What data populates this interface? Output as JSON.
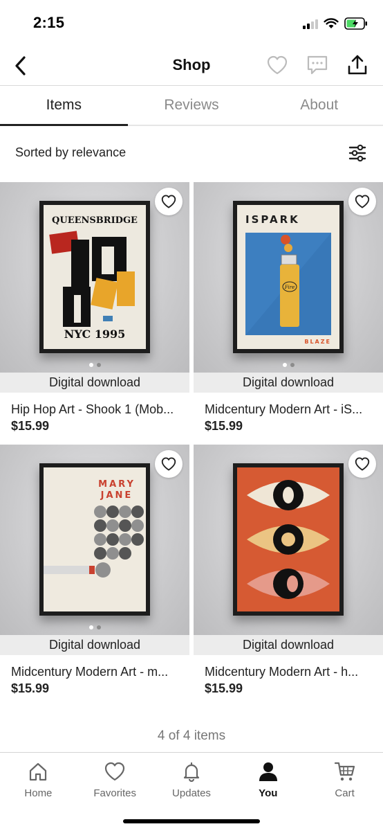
{
  "status_bar": {
    "time": "2:15"
  },
  "header": {
    "title": "Shop",
    "back_icon": "chevron-left-icon",
    "actions": [
      "heart-icon",
      "message-icon",
      "share-icon"
    ]
  },
  "tabs": [
    {
      "label": "Items",
      "active": true
    },
    {
      "label": "Reviews",
      "active": false
    },
    {
      "label": "About",
      "active": false
    }
  ],
  "sort": {
    "label": "Sorted by relevance",
    "icon": "filter-sliders-icon"
  },
  "listings": [
    {
      "badge": "Digital download",
      "title": "Hip Hop Art - Shook 1 (Mob...",
      "price": "$15.99",
      "poster": {
        "top": "QUEENSBRIDGE",
        "bottom": "NYC 1995"
      }
    },
    {
      "badge": "Digital download",
      "title": "Midcentury Modern Art - iS...",
      "price": "$15.99",
      "poster": {
        "top": "ISPARK",
        "bottom": "BLAZE",
        "lighter": "Fire"
      }
    },
    {
      "badge": "Digital download",
      "title": "Midcentury Modern Art - m...",
      "price": "$15.99",
      "poster": {
        "line1": "MARY",
        "line2": "JANE"
      }
    },
    {
      "badge": "Digital download",
      "title": "Midcentury Modern Art  - h...",
      "price": "$15.99",
      "poster": {}
    }
  ],
  "items_count": "4 of 4 items",
  "bottom_nav": [
    {
      "label": "Home",
      "icon": "home-icon",
      "active": false
    },
    {
      "label": "Favorites",
      "icon": "heart-icon",
      "active": false
    },
    {
      "label": "Updates",
      "icon": "bell-icon",
      "active": false
    },
    {
      "label": "You",
      "icon": "person-icon",
      "active": true
    },
    {
      "label": "Cart",
      "icon": "cart-icon",
      "active": false
    }
  ],
  "colors": {
    "text": "#222222",
    "muted": "#8a8a8a",
    "badge_bg": "#ececec",
    "battery_green": "#4cd964"
  }
}
